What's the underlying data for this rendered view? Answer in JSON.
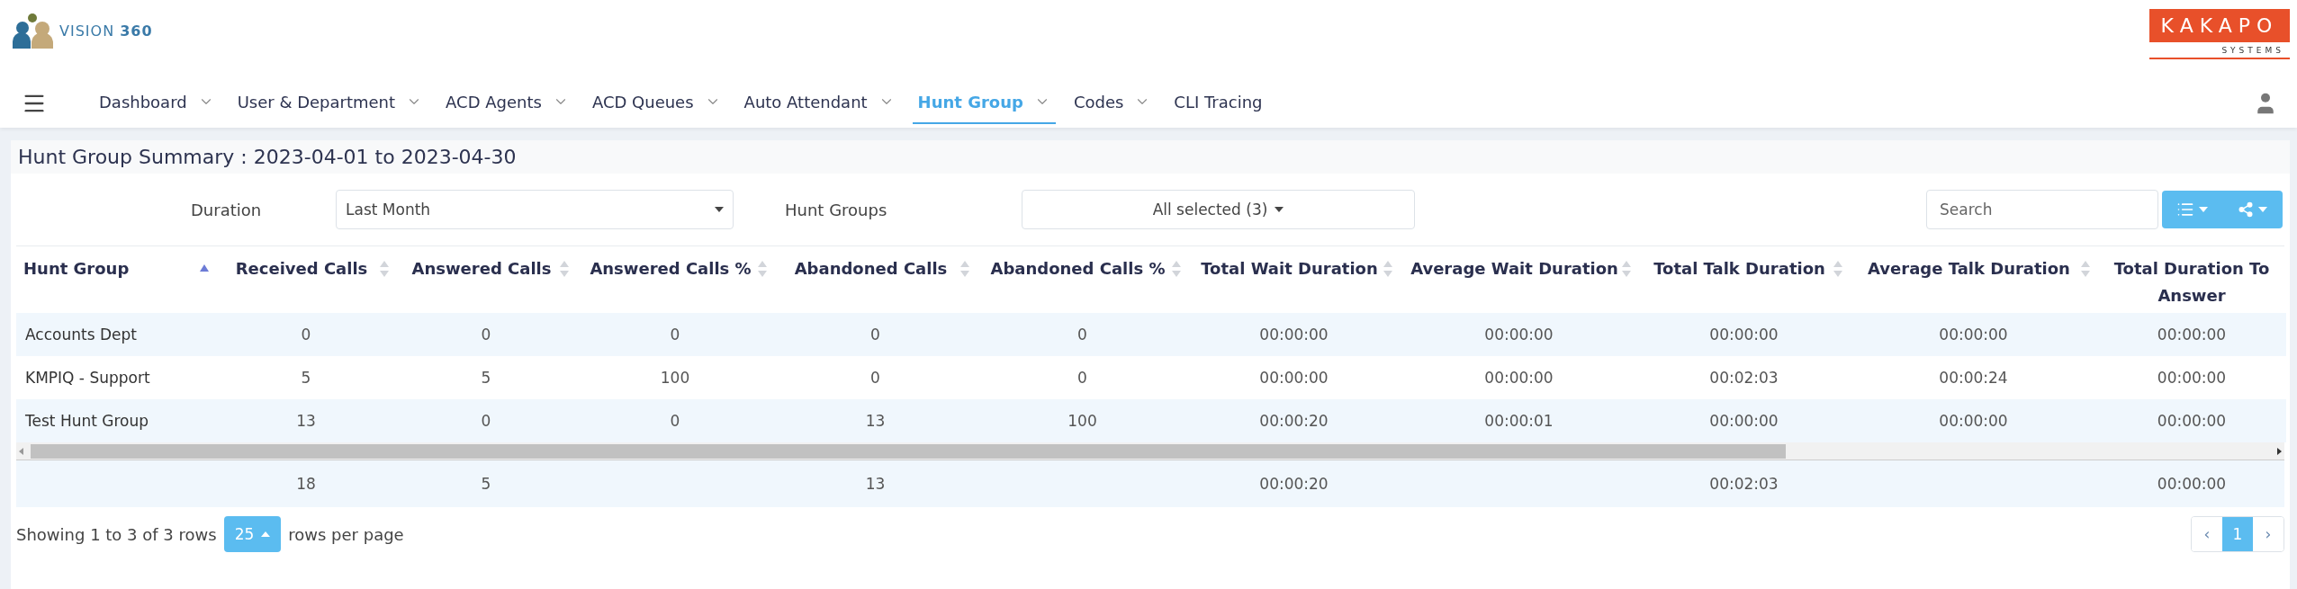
{
  "brand": {
    "name": "VISION",
    "suffix": "360"
  },
  "partner_logo": {
    "name": "KAKAPO",
    "tagline": "SYSTEMS"
  },
  "nav": [
    {
      "label": "Dashboard",
      "selected": false,
      "dropdown": true
    },
    {
      "label": "User & Department",
      "selected": false,
      "dropdown": true
    },
    {
      "label": "ACD Agents",
      "selected": false,
      "dropdown": true
    },
    {
      "label": "ACD Queues",
      "selected": false,
      "dropdown": true
    },
    {
      "label": "Auto Attendant",
      "selected": false,
      "dropdown": true
    },
    {
      "label": "Hunt Group",
      "selected": true,
      "dropdown": true
    },
    {
      "label": "Codes",
      "selected": false,
      "dropdown": true
    },
    {
      "label": "CLI Tracing",
      "selected": false,
      "dropdown": false
    }
  ],
  "title": "Hunt Group Summary : 2023-04-01 to 2023-04-30",
  "filters": {
    "duration_label": "Duration",
    "duration_value": "Last Month",
    "groups_label": "Hunt Groups",
    "groups_value": "All selected (3)",
    "search_placeholder": "Search"
  },
  "table": {
    "columns": [
      {
        "label": "Hunt Group",
        "sorted": true
      },
      {
        "label": "Received Calls",
        "sorted": false
      },
      {
        "label": "Answered Calls",
        "sorted": false
      },
      {
        "label": "Answered Calls %",
        "sorted": false
      },
      {
        "label": "Abandoned Calls",
        "sorted": false
      },
      {
        "label": "Abandoned Calls %",
        "sorted": false
      },
      {
        "label": "Total Wait Duration",
        "sorted": false
      },
      {
        "label": "Average Wait Duration",
        "sorted": false
      },
      {
        "label": "Total Talk Duration",
        "sorted": false
      },
      {
        "label": "Average Talk Duration",
        "sorted": false
      },
      {
        "label": "Total Duration To Answer"
      }
    ],
    "rows": [
      [
        "Accounts Dept",
        "0",
        "0",
        "0",
        "0",
        "0",
        "00:00:00",
        "00:00:00",
        "00:00:00",
        "00:00:00",
        "00:00:00"
      ],
      [
        "KMPIQ - Support",
        "5",
        "5",
        "100",
        "0",
        "0",
        "00:00:00",
        "00:00:00",
        "00:02:03",
        "00:00:24",
        "00:00:00"
      ],
      [
        "Test Hunt Group",
        "13",
        "0",
        "0",
        "13",
        "100",
        "00:00:20",
        "00:00:01",
        "00:00:00",
        "00:00:00",
        "00:00:00"
      ]
    ],
    "totals": {
      "received_calls": "18",
      "answered_calls": "5",
      "abandoned_calls": "13",
      "total_wait_duration": "00:00:20",
      "total_talk_duration": "00:02:03",
      "total_duration_to_answer": "00:00:00"
    }
  },
  "pagination": {
    "summary": "Showing 1 to 3 of 3 rows",
    "page_size": "25",
    "page_size_label": "rows per page",
    "prev": "‹",
    "pages": [
      {
        "label": "1",
        "selected": true
      }
    ],
    "next": "›"
  }
}
